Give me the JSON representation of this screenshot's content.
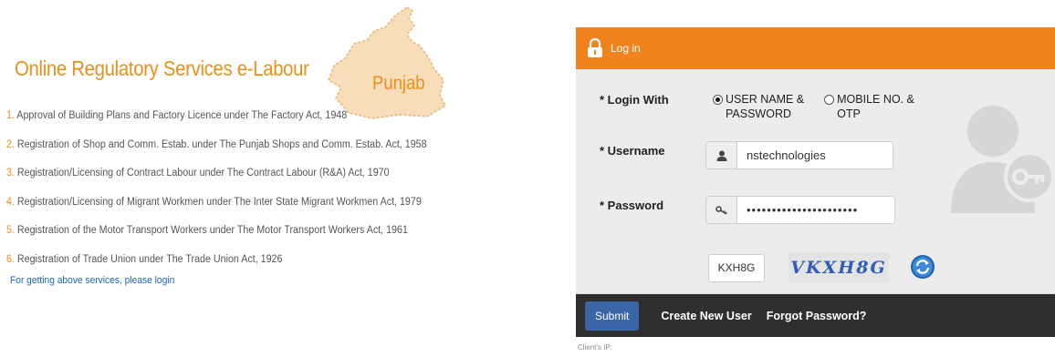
{
  "left": {
    "title": "Online Regulatory Services e-Labour",
    "state": "Punjab",
    "services": [
      {
        "num": "1.",
        "text": "Approval of Building Plans and Factory Licence under The Factory Act, 1948"
      },
      {
        "num": "2.",
        "text": "Registration of Shop and Comm. Estab. under The Punjab Shops and Comm. Estab. Act, 1958"
      },
      {
        "num": "3.",
        "text": "Registration/Licensing of  Contract Labour under The Contract Labour (R&A) Act, 1970"
      },
      {
        "num": "4.",
        "text": "Registration/Licensing of Migrant Workmen under The Inter State Migrant Workmen Act, 1979"
      },
      {
        "num": "5.",
        "text": "Registration of the Motor Transport Workers under The Motor Transport Workers Act, 1961"
      },
      {
        "num": "6.",
        "text": "Registration of Trade Union under The Trade Union Act, 1926"
      }
    ],
    "hint": "For getting above services, please login"
  },
  "login": {
    "header": "Log in",
    "login_with_label": "* Login With",
    "options": [
      {
        "line1": "USER NAME &",
        "line2": "PASSWORD",
        "selected": true
      },
      {
        "line1": "MOBILE NO. &",
        "line2": "OTP",
        "selected": false
      }
    ],
    "username_label": "* Username",
    "username_value": "nstechnologies",
    "password_label": "* Password",
    "password_value": "••••••••••••••••••••••",
    "captcha_value": "KXH8G",
    "captcha_text": "VKXH8G",
    "submit": "Submit",
    "create_user": "Create New User",
    "forgot_password": "Forgot Password?",
    "client_ip": "Client's IP:"
  },
  "colors": {
    "accent_orange": "#f0831d",
    "title_orange": "#e8901c",
    "link_blue": "#1565c0",
    "footer_dark": "#2f2f2f",
    "submit_blue": "#3a66a8"
  }
}
